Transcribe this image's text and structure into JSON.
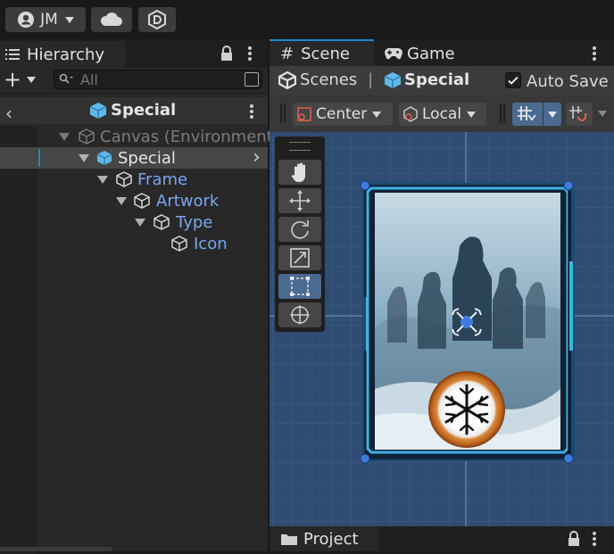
{
  "topbar": {
    "account_label": "JM"
  },
  "hierarchy": {
    "tab_label": "Hierarchy",
    "search_placeholder": "All",
    "scene_title": "Special",
    "items": [
      {
        "label": "Canvas (Environment"
      },
      {
        "label": "Special"
      },
      {
        "label": "Frame"
      },
      {
        "label": "Artwork"
      },
      {
        "label": "Type"
      },
      {
        "label": "Icon"
      }
    ]
  },
  "scene_panel": {
    "tabs": [
      {
        "label": "Scene"
      },
      {
        "label": "Game"
      }
    ],
    "breadcrumb": {
      "root": "Scenes",
      "separator": "|",
      "current": "Special"
    },
    "auto_save_label": "Auto Save",
    "auto_save_checked": true,
    "pivot_label": "Center",
    "space_label": "Local"
  },
  "project": {
    "tab_label": "Project"
  },
  "colors": {
    "accent": "#1e88d6",
    "prefab_text": "#7aa7f0",
    "selected_row": "#464646",
    "scene_bg": "#2f4d73",
    "handle": "#3f7ce0"
  }
}
